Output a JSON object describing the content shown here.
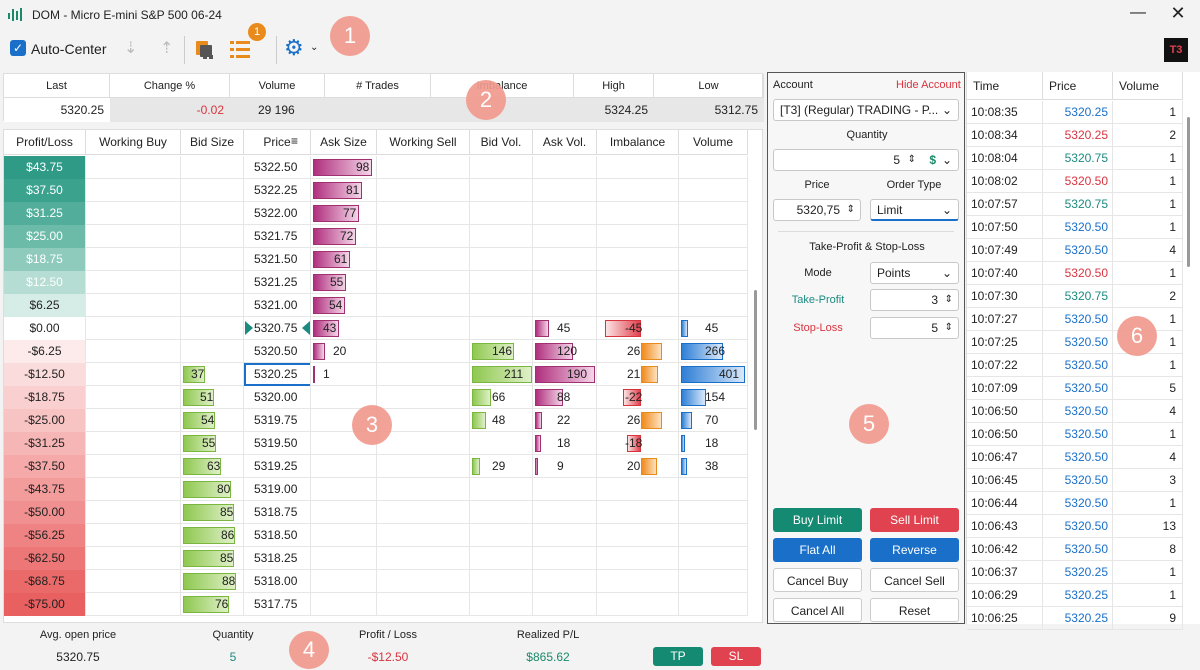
{
  "window": {
    "title": "DOM - Micro E-mini S&P 500 06-24"
  },
  "toolbar": {
    "auto_center_label": "Auto-Center",
    "badge_count": "1",
    "callouts": [
      "1",
      "2",
      "3",
      "4",
      "5",
      "6"
    ]
  },
  "stats": {
    "headers": [
      "Last",
      "Change %",
      "Volume",
      "# Trades",
      "Imbalance",
      "High",
      "Low"
    ],
    "values": [
      "5320.25",
      "-0.02",
      "29 196",
      "",
      "",
      "5324.25",
      "5312.75"
    ]
  },
  "dom": {
    "headers": [
      "Profit/Loss",
      "Working Buy",
      "Bid Size",
      "Price",
      "Ask Size",
      "Working Sell",
      "Bid Vol.",
      "Ask Vol.",
      "Imbalance",
      "Volume"
    ],
    "rows": [
      {
        "pl": "$43.75",
        "bid": "",
        "price": "5322.50",
        "ask": "98",
        "bidvol": "",
        "askvol": "",
        "imb": "",
        "vol": ""
      },
      {
        "pl": "$37.50",
        "bid": "",
        "price": "5322.25",
        "ask": "81",
        "bidvol": "",
        "askvol": "",
        "imb": "",
        "vol": ""
      },
      {
        "pl": "$31.25",
        "bid": "",
        "price": "5322.00",
        "ask": "77",
        "bidvol": "",
        "askvol": "",
        "imb": "",
        "vol": ""
      },
      {
        "pl": "$25.00",
        "bid": "",
        "price": "5321.75",
        "ask": "72",
        "bidvol": "",
        "askvol": "",
        "imb": "",
        "vol": ""
      },
      {
        "pl": "$18.75",
        "bid": "",
        "price": "5321.50",
        "ask": "61",
        "bidvol": "",
        "askvol": "",
        "imb": "",
        "vol": ""
      },
      {
        "pl": "$12.50",
        "bid": "",
        "price": "5321.25",
        "ask": "55",
        "bidvol": "",
        "askvol": "",
        "imb": "",
        "vol": ""
      },
      {
        "pl": "$6.25",
        "bid": "",
        "price": "5321.00",
        "ask": "54",
        "bidvol": "",
        "askvol": "",
        "imb": "",
        "vol": ""
      },
      {
        "pl": "$0.00",
        "bid": "",
        "price": "5320.75",
        "ask": "43",
        "bidvol": "",
        "askvol": "45",
        "imb": "-45",
        "vol": "45"
      },
      {
        "pl": "-$6.25",
        "bid": "",
        "price": "5320.50",
        "ask": "20",
        "bidvol": "146",
        "askvol": "120",
        "imb": "26",
        "vol": "266"
      },
      {
        "pl": "-$12.50",
        "bid": "37",
        "price": "5320.25",
        "ask": "1",
        "bidvol": "211",
        "askvol": "190",
        "imb": "21",
        "vol": "401"
      },
      {
        "pl": "-$18.75",
        "bid": "51",
        "price": "5320.00",
        "ask": "",
        "bidvol": "66",
        "askvol": "88",
        "imb": "-22",
        "vol": "154"
      },
      {
        "pl": "-$25.00",
        "bid": "54",
        "price": "5319.75",
        "ask": "",
        "bidvol": "48",
        "askvol": "22",
        "imb": "26",
        "vol": "70"
      },
      {
        "pl": "-$31.25",
        "bid": "55",
        "price": "5319.50",
        "ask": "",
        "bidvol": "",
        "askvol": "18",
        "imb": "-18",
        "vol": "18"
      },
      {
        "pl": "-$37.50",
        "bid": "63",
        "price": "5319.25",
        "ask": "",
        "bidvol": "29",
        "askvol": "9",
        "imb": "20",
        "vol": "38"
      },
      {
        "pl": "-$43.75",
        "bid": "80",
        "price": "5319.00",
        "ask": "",
        "bidvol": "",
        "askvol": "",
        "imb": "",
        "vol": ""
      },
      {
        "pl": "-$50.00",
        "bid": "85",
        "price": "5318.75",
        "ask": "",
        "bidvol": "",
        "askvol": "",
        "imb": "",
        "vol": ""
      },
      {
        "pl": "-$56.25",
        "bid": "86",
        "price": "5318.50",
        "ask": "",
        "bidvol": "",
        "askvol": "",
        "imb": "",
        "vol": ""
      },
      {
        "pl": "-$62.50",
        "bid": "85",
        "price": "5318.25",
        "ask": "",
        "bidvol": "",
        "askvol": "",
        "imb": "",
        "vol": ""
      },
      {
        "pl": "-$68.75",
        "bid": "88",
        "price": "5318.00",
        "ask": "",
        "bidvol": "",
        "askvol": "",
        "imb": "",
        "vol": ""
      },
      {
        "pl": "-$75.00",
        "bid": "76",
        "price": "5317.75",
        "ask": "",
        "bidvol": "",
        "askvol": "",
        "imb": "",
        "vol": ""
      }
    ]
  },
  "position": {
    "labels": [
      "Avg. open price",
      "Quantity",
      "Profit / Loss",
      "Realized P/L"
    ],
    "values": [
      "5320.75",
      "5",
      "-$12.50",
      "$865.62"
    ],
    "tp_label": "TP",
    "sl_label": "SL"
  },
  "order": {
    "account_label": "Account",
    "hide_account": "Hide Account",
    "account_value": "[T3] (Regular) TRADING - P...",
    "quantity_label": "Quantity",
    "quantity_value": "5",
    "price_label": "Price",
    "price_value": "5320,75",
    "order_type_label": "Order Type",
    "order_type_value": "Limit",
    "tpsl_title": "Take-Profit & Stop-Loss",
    "mode_label": "Mode",
    "mode_value": "Points",
    "tp_label": "Take-Profit",
    "tp_value": "3",
    "sl_label": "Stop-Loss",
    "sl_value": "5",
    "buttons": {
      "buy_limit": "Buy Limit",
      "sell_limit": "Sell Limit",
      "flat_all": "Flat All",
      "reverse": "Reverse",
      "cancel_buy": "Cancel Buy",
      "cancel_sell": "Cancel Sell",
      "cancel_all": "Cancel All",
      "reset": "Reset"
    }
  },
  "time_sales": {
    "headers": [
      "Time",
      "Price",
      "Volume"
    ],
    "rows": [
      {
        "t": "10:08:35",
        "p": "5320.25",
        "v": "1",
        "c": "blue"
      },
      {
        "t": "10:08:34",
        "p": "5320.25",
        "v": "2",
        "c": "red"
      },
      {
        "t": "10:08:04",
        "p": "5320.75",
        "v": "1",
        "c": "teal"
      },
      {
        "t": "10:08:02",
        "p": "5320.50",
        "v": "1",
        "c": "red"
      },
      {
        "t": "10:07:57",
        "p": "5320.75",
        "v": "1",
        "c": "teal"
      },
      {
        "t": "10:07:50",
        "p": "5320.50",
        "v": "1",
        "c": "blue"
      },
      {
        "t": "10:07:49",
        "p": "5320.50",
        "v": "4",
        "c": "blue"
      },
      {
        "t": "10:07:40",
        "p": "5320.50",
        "v": "1",
        "c": "red"
      },
      {
        "t": "10:07:30",
        "p": "5320.75",
        "v": "2",
        "c": "teal"
      },
      {
        "t": "10:07:27",
        "p": "5320.50",
        "v": "1",
        "c": "blue"
      },
      {
        "t": "10:07:25",
        "p": "5320.50",
        "v": "1",
        "c": "blue"
      },
      {
        "t": "10:07:22",
        "p": "5320.50",
        "v": "1",
        "c": "blue"
      },
      {
        "t": "10:07:09",
        "p": "5320.50",
        "v": "5",
        "c": "blue"
      },
      {
        "t": "10:06:50",
        "p": "5320.50",
        "v": "4",
        "c": "blue"
      },
      {
        "t": "10:06:50",
        "p": "5320.50",
        "v": "1",
        "c": "blue"
      },
      {
        "t": "10:06:47",
        "p": "5320.50",
        "v": "4",
        "c": "blue"
      },
      {
        "t": "10:06:45",
        "p": "5320.50",
        "v": "3",
        "c": "blue"
      },
      {
        "t": "10:06:44",
        "p": "5320.50",
        "v": "1",
        "c": "blue"
      },
      {
        "t": "10:06:43",
        "p": "5320.50",
        "v": "13",
        "c": "blue"
      },
      {
        "t": "10:06:42",
        "p": "5320.50",
        "v": "8",
        "c": "blue"
      },
      {
        "t": "10:06:37",
        "p": "5320.25",
        "v": "1",
        "c": "blue"
      },
      {
        "t": "10:06:29",
        "p": "5320.25",
        "v": "1",
        "c": "blue"
      },
      {
        "t": "10:06:25",
        "p": "5320.25",
        "v": "9",
        "c": "blue"
      }
    ]
  },
  "colors": {
    "buy": "#158a72",
    "sell": "#e0424f",
    "blue": "#1a6fc9",
    "red": "#d8343f",
    "teal": "#1b8a80",
    "neg": "#d8343f",
    "pos": "#1b8a6a"
  }
}
